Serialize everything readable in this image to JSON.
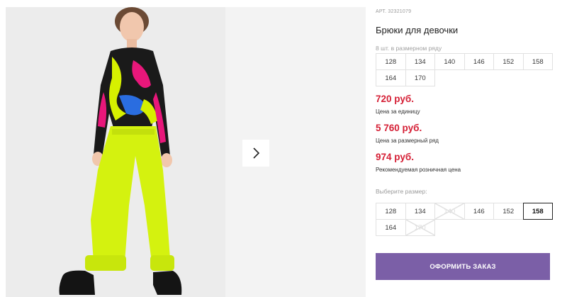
{
  "product": {
    "sku": "АРТ. 32321079",
    "title": "Брюки для девочки"
  },
  "size_range": {
    "caption": "8 шт. в размерном ряду",
    "sizes": [
      "128",
      "134",
      "140",
      "146",
      "152",
      "158",
      "164",
      "170"
    ]
  },
  "prices": [
    {
      "value": "720 руб.",
      "caption": "Цена за единицу"
    },
    {
      "value": "5 760 руб.",
      "caption": "Цена за размерный ряд"
    },
    {
      "value": "974 руб.",
      "caption": "Рекомендуемая розничная цена"
    }
  ],
  "size_select": {
    "caption": "Выберите размер:",
    "sizes": [
      {
        "label": "128",
        "state": "available"
      },
      {
        "label": "134",
        "state": "available"
      },
      {
        "label": "140",
        "state": "disabled"
      },
      {
        "label": "146",
        "state": "available"
      },
      {
        "label": "152",
        "state": "available"
      },
      {
        "label": "158",
        "state": "selected"
      },
      {
        "label": "164",
        "state": "available"
      },
      {
        "label": "170",
        "state": "disabled"
      }
    ]
  },
  "order_button": {
    "label": "ОФОРМИТЬ ЗАКАЗ"
  },
  "colors": {
    "price": "#d51f35",
    "button": "#7b5fa7",
    "pants": "#d4f20f"
  },
  "icons": {
    "next": "chevron-right-icon"
  }
}
